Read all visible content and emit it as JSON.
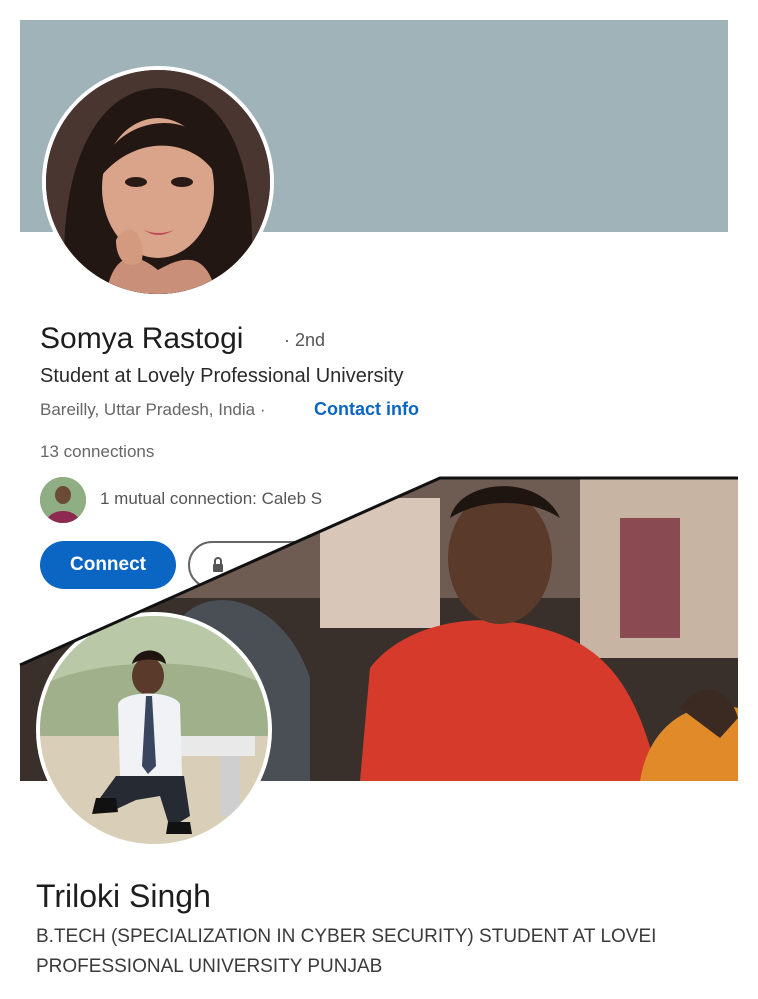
{
  "profile_top": {
    "name": "Somya Rastogi",
    "degree": "· 2nd",
    "headline": "Student at Lovely Professional University",
    "location": "Bareilly, Uttar Pradesh, India ·",
    "contact_info": "Contact info",
    "connections": "13 connections",
    "mutual": "1 mutual connection: Caleb S",
    "connect_label": "Connect",
    "message_icon": "lock-icon",
    "banner_color": "#a0b3b8",
    "accent_color": "#0a66c2"
  },
  "profile_bottom": {
    "name": "Triloki Singh",
    "headline_line1": "B.TECH (SPECIALIZATION IN CYBER SECURITY) STUDENT AT LOVEI",
    "headline_line2": "PROFESSIONAL UNIVERSITY PUNJAB"
  }
}
